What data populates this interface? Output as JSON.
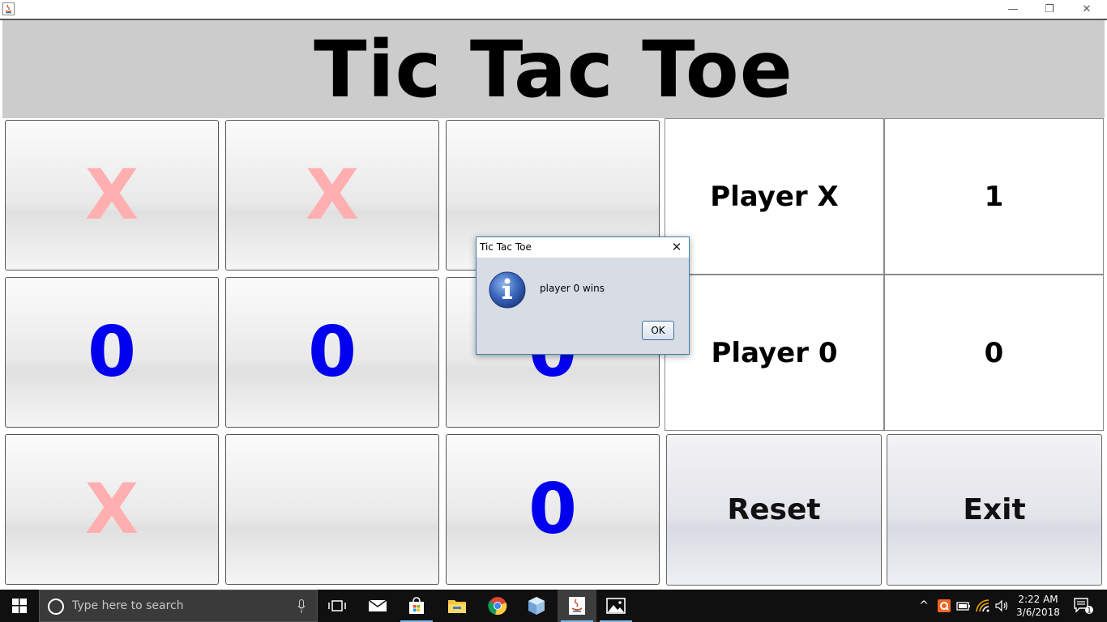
{
  "window": {
    "title": "",
    "controls": {
      "minimize": "—",
      "maximize": "❐",
      "close": "✕"
    }
  },
  "header": {
    "title": "Tic Tac Toe"
  },
  "board": [
    [
      {
        "mark": "X"
      },
      {
        "mark": "X"
      },
      {
        "mark": ""
      }
    ],
    [
      {
        "mark": "0"
      },
      {
        "mark": "0"
      },
      {
        "mark": "0"
      }
    ],
    [
      {
        "mark": "X"
      },
      {
        "mark": ""
      },
      {
        "mark": "0"
      }
    ]
  ],
  "scoreboard": {
    "player_x_label": "Player X",
    "player_x_score": "1",
    "player_o_label": "Player 0",
    "player_o_score": "0"
  },
  "buttons": {
    "reset": "Reset",
    "exit": "Exit"
  },
  "dialog": {
    "title": "Tic Tac Toe",
    "message": "player 0 wins",
    "ok": "OK",
    "close": "✕"
  },
  "taskbar": {
    "search_placeholder": "Type here to search",
    "time": "2:22 AM",
    "date": "3/6/2018",
    "notification_count": "1",
    "pinned": [
      "task-view",
      "mail",
      "store",
      "file-explorer",
      "chrome",
      "virtualbox",
      "java",
      "photos"
    ]
  },
  "colors": {
    "x_mark": "#ffafaf",
    "o_mark": "#0000ee",
    "header_bg": "#cccccc"
  }
}
